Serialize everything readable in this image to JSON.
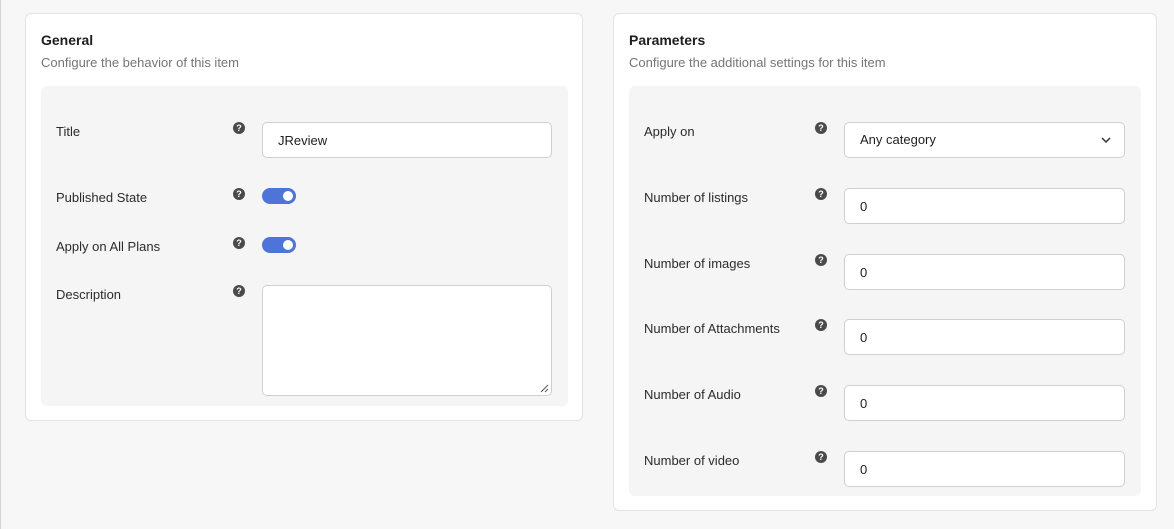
{
  "general": {
    "title": "General",
    "subtitle": "Configure the behavior of this item",
    "fields": {
      "title": {
        "label": "Title",
        "value": "JReview"
      },
      "published_state": {
        "label": "Published State",
        "enabled": true
      },
      "apply_all_plans": {
        "label": "Apply on All Plans",
        "enabled": true
      },
      "description": {
        "label": "Description",
        "value": ""
      }
    }
  },
  "parameters": {
    "title": "Parameters",
    "subtitle": "Configure the additional settings for this item",
    "fields": {
      "apply_on": {
        "label": "Apply on",
        "selected": "Any category"
      },
      "listings": {
        "label": "Number of listings",
        "value": "0"
      },
      "images": {
        "label": "Number of images",
        "value": "0"
      },
      "attachments": {
        "label": "Number of Attachments",
        "value": "0"
      },
      "audio": {
        "label": "Number of Audio",
        "value": "0"
      },
      "video": {
        "label": "Number of video",
        "value": "0"
      }
    }
  },
  "icons": {
    "help": "?",
    "help_name": "question-circle-icon",
    "chevron_name": "chevron-down-icon"
  },
  "colors": {
    "toggle_on": "#4e73d9",
    "page_background": "#f7f7f7",
    "panel_background": "#f5f5f5"
  }
}
